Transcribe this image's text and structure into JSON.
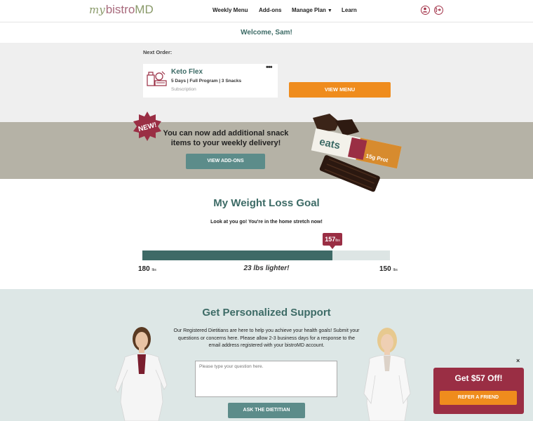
{
  "header": {
    "logo": {
      "my": "my",
      "bistro": "bistro",
      "md": "MD"
    },
    "nav": {
      "weekly_menu": "Weekly Menu",
      "add_ons": "Add-ons",
      "manage_plan": "Manage Plan",
      "learn": "Learn"
    },
    "icons": [
      "user-icon",
      "logout-icon"
    ]
  },
  "welcome": "Welcome, Sam!",
  "next_order": {
    "label": "Next Order:",
    "plan_name": "Keto Flex",
    "details": "5 Days | Full Program | 3 Snacks",
    "type": "Subscription",
    "more": "•••",
    "view_menu_label": "VIEW MENU"
  },
  "promo": {
    "badge": "NEW!",
    "text": "You can now add additional snack items to your weekly delivery!",
    "button_label": "VIEW ADD-ONS",
    "product_label": "eats",
    "product_sub": "15g Prot"
  },
  "goal": {
    "title": "My Weight Loss Goal",
    "subtitle": "Look at you go! You're in the home stretch now!",
    "start_weight": "180",
    "current_weight": "157",
    "end_weight": "150",
    "unit": "lbs",
    "lighter_text": "23 lbs lighter!",
    "progress_fraction": 0.767
  },
  "support": {
    "title": "Get Personalized Support",
    "text": "Our Registered Dietitians are here to help you achieve your health goals! Submit your questions or concerns here. Please allow 2-3 business days for a response to the email address registered with your bistroMD account.",
    "placeholder": "Please type your question here.",
    "button_label": "ASK THE DIETITIAN"
  },
  "referral": {
    "title": "Get $57 Off!",
    "button_label": "REFER A FRIEND",
    "close": "×"
  },
  "colors": {
    "teal": "#3d6b66",
    "orange": "#ef8c1d",
    "burgundy": "#9a2e44",
    "gray_band": "#efefef",
    "promo_band": "#b5b2a6",
    "support_band": "#dde7e6"
  }
}
